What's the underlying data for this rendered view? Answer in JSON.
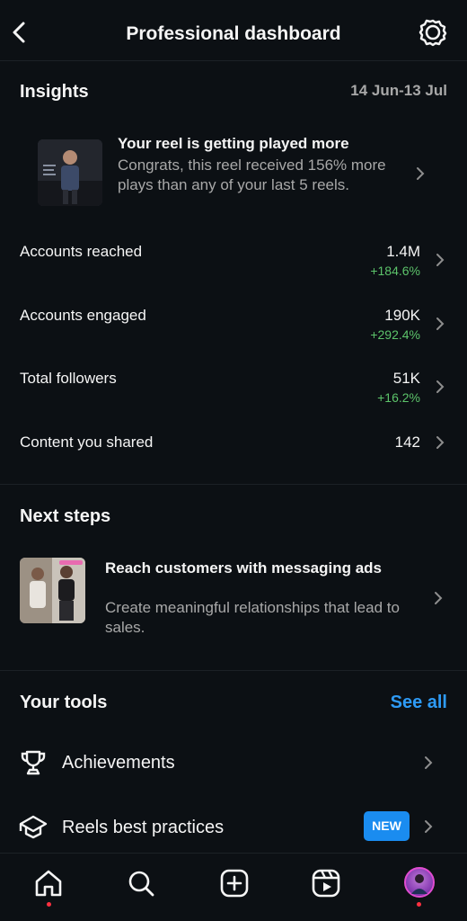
{
  "header": {
    "title": "Professional dashboard"
  },
  "insights": {
    "title": "Insights",
    "date_range": "14 Jun-13 Jul",
    "reel": {
      "title": "Your reel is getting played more",
      "description": "Congrats, this reel received 156% more plays than any of your last 5 reels."
    },
    "metrics": [
      {
        "label": "Accounts reached",
        "value": "1.4M",
        "delta": "+184.6%"
      },
      {
        "label": "Accounts engaged",
        "value": "190K",
        "delta": "+292.4%"
      },
      {
        "label": "Total followers",
        "value": "51K",
        "delta": "+16.2%"
      },
      {
        "label": "Content you shared",
        "value": "142",
        "delta": ""
      }
    ]
  },
  "next_steps": {
    "title": "Next steps",
    "card": {
      "title": "Reach customers with messaging ads",
      "description": "Create meaningful relationships that lead to sales."
    }
  },
  "tools": {
    "title": "Your tools",
    "see_all": "See all",
    "items": [
      {
        "label": "Achievements",
        "icon": "trophy-icon"
      },
      {
        "label": "Reels best practices",
        "icon": "graduation-cap-icon",
        "badge": "NEW"
      }
    ]
  },
  "tabbar": {
    "items": [
      "home-icon",
      "search-icon",
      "create-icon",
      "reels-icon",
      "profile-avatar"
    ]
  },
  "colors": {
    "background": "#0c1014",
    "accent_blue": "#2e9bf6",
    "positive_green": "#5cc36a",
    "badge_blue": "#1a8cf0",
    "notification_red": "#ff3040"
  }
}
